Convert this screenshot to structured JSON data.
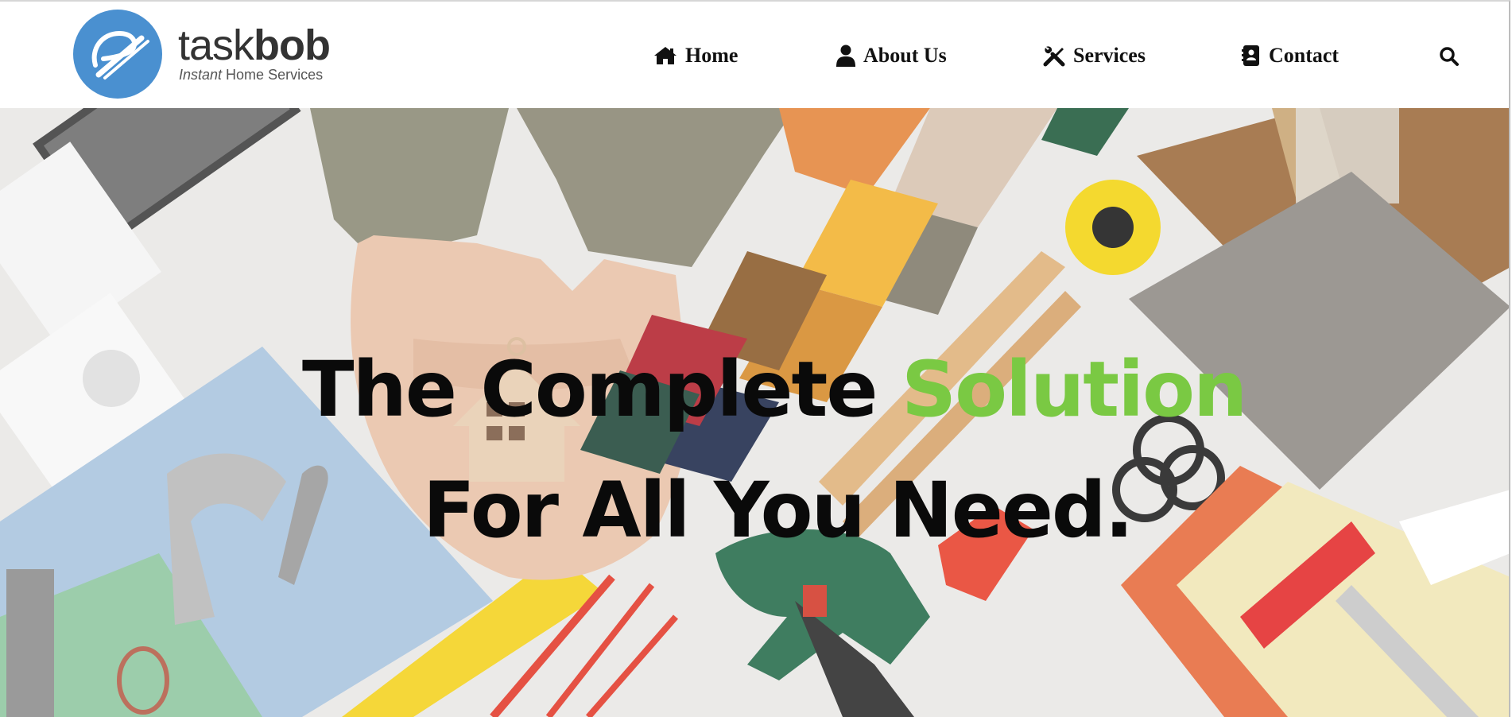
{
  "brand": {
    "name_light": "task",
    "name_bold": "bob",
    "tagline_italic": "Instant",
    "tagline_rest": " Home Services",
    "logo_color": "#4a90d0"
  },
  "nav": {
    "items": [
      {
        "label": "Home",
        "icon": "home-icon"
      },
      {
        "label": "About Us",
        "icon": "user-icon"
      },
      {
        "label": "Services",
        "icon": "tools-icon"
      },
      {
        "label": "Contact",
        "icon": "address-card-icon"
      }
    ],
    "search_icon": "search-icon"
  },
  "hero": {
    "line1_prefix": "The Complete ",
    "line1_accent": "Solution",
    "line2": "For All You Need.",
    "accent_color": "#7ac943",
    "background": "hands holding a small wooden house over a flat-lay of home repair tools and materials"
  }
}
